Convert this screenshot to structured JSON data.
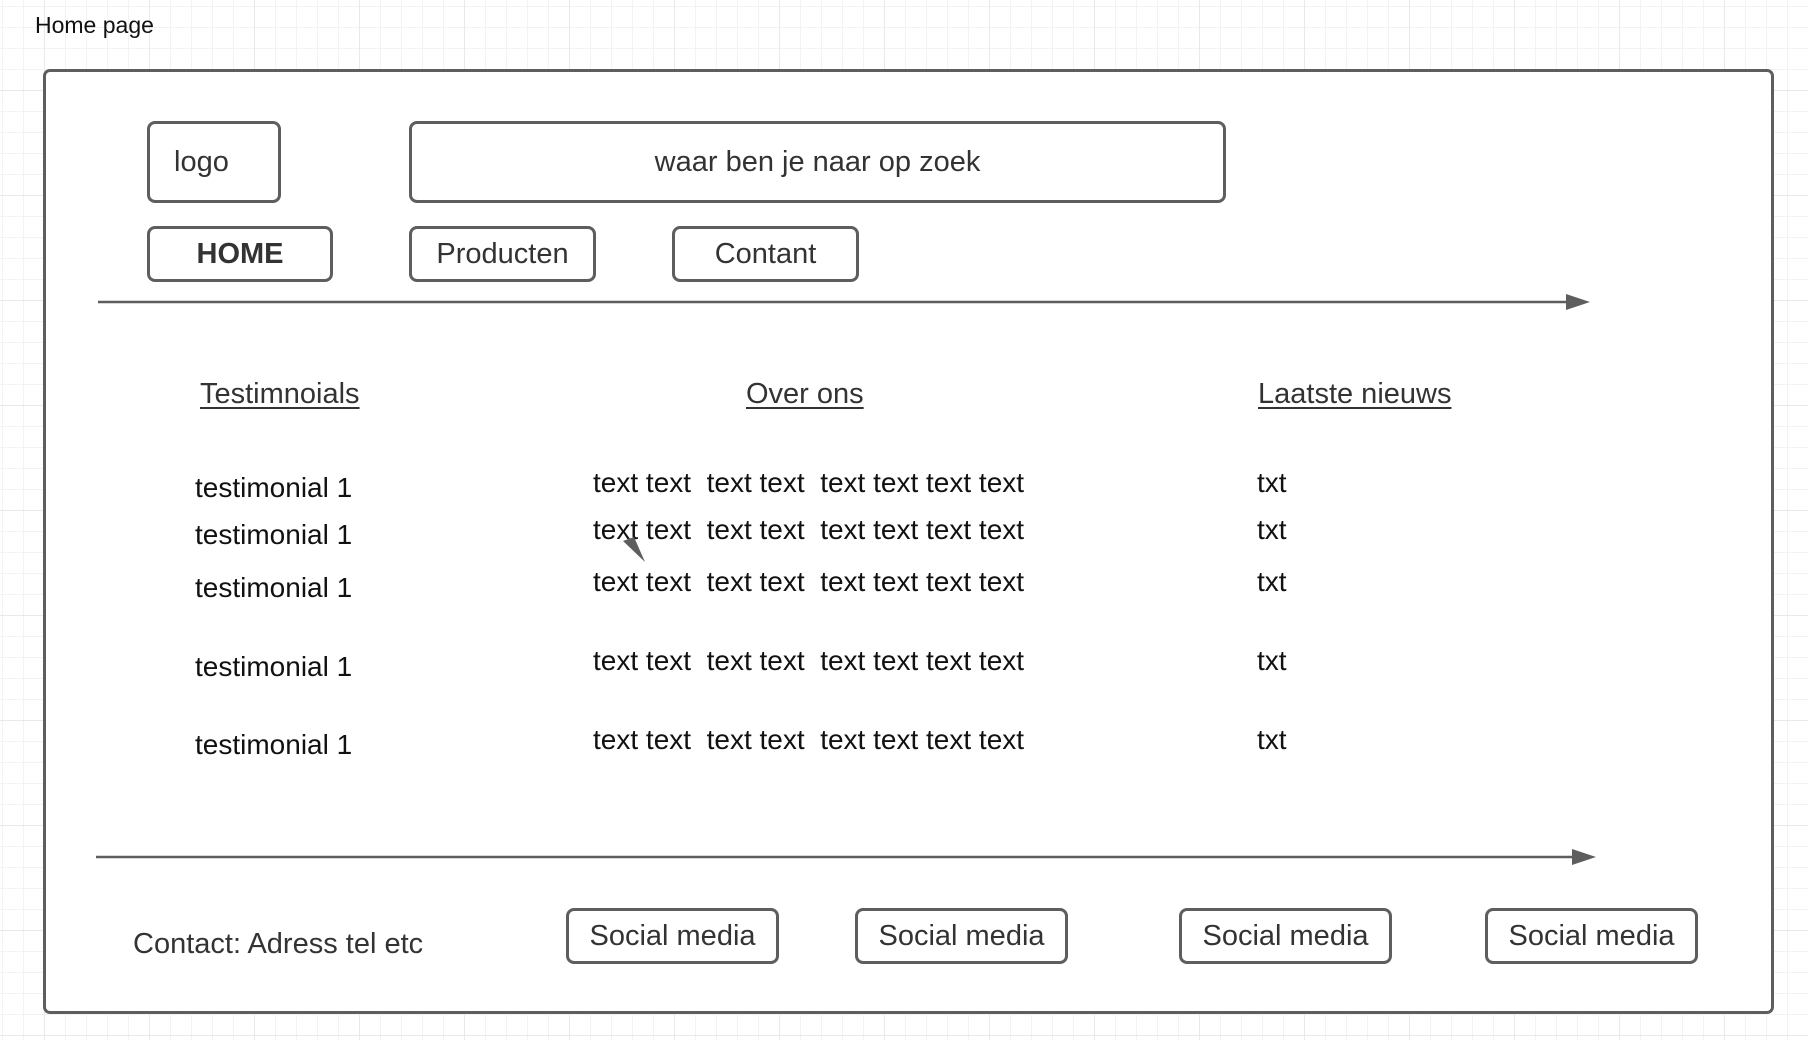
{
  "page_label": "Home page",
  "header": {
    "logo": "logo",
    "search_placeholder": "waar ben je naar op zoek"
  },
  "nav": {
    "home": "HOME",
    "producten": "Producten",
    "contact": "Contant"
  },
  "columns": {
    "testimonials": {
      "heading": "Testimnoials",
      "items": [
        "testimonial 1",
        "testimonial 1",
        "testimonial 1",
        "testimonial 1",
        "testimonial 1"
      ]
    },
    "over_ons": {
      "heading": "Over ons",
      "items": [
        "text text  text text  text text text text",
        "text text  text text  text text text text",
        "text text  text text  text text text text",
        "text text  text text  text text text text",
        "text text  text text  text text text text"
      ]
    },
    "nieuws": {
      "heading": "Laatste nieuws",
      "items": [
        "txt",
        "txt",
        "txt",
        "txt",
        "txt"
      ]
    }
  },
  "footer": {
    "contact": "Contact: Adress tel etc",
    "social": [
      "Social media",
      "Social media",
      "Social media",
      "Social media"
    ]
  },
  "colors": {
    "stroke": "#5e5e5e",
    "text": "#333333",
    "grid": "#e9e9e9"
  }
}
